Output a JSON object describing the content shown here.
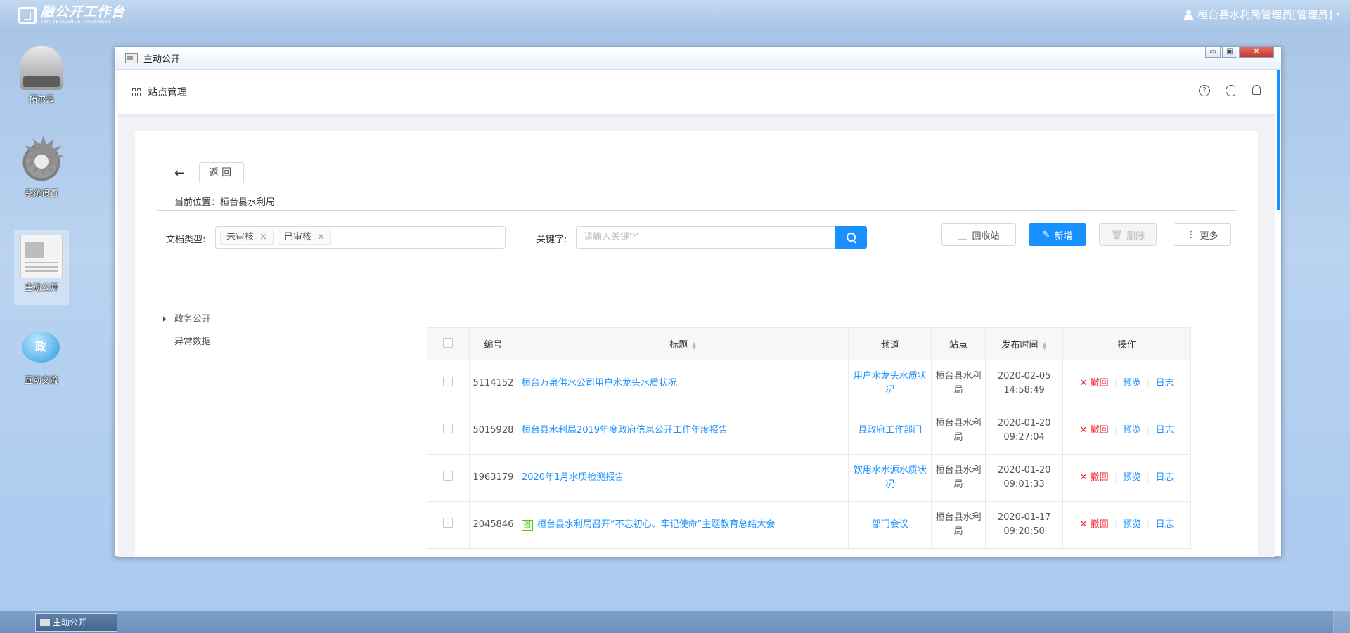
{
  "topbar": {
    "logo_title": "融公开工作台",
    "logo_sub": "CONVERGENCE OPENNESS",
    "user": "桓台县水利局管理员[管理员]"
  },
  "desktop": [
    {
      "label": "拓尔云"
    },
    {
      "label": "系统设置"
    },
    {
      "label": "主动公开"
    },
    {
      "label": "互动交流",
      "icon_text": "政"
    }
  ],
  "window": {
    "title": "主动公开",
    "header_title": "站点管理",
    "back_label": "返回",
    "location": "当前位置：桓台县水利局"
  },
  "filters": {
    "doc_type_label": "文档类型:",
    "tags": [
      "未审核",
      "已审核"
    ],
    "keyword_label": "关键字:",
    "keyword_placeholder": "请输入关键字",
    "recycle_label": "回收站",
    "new_label": "新增",
    "delete_label": "删除",
    "more_label": "更多"
  },
  "tree": {
    "root": "政务公开",
    "child": "异常数据"
  },
  "table": {
    "headers": {
      "id": "编号",
      "title": "标题",
      "channel": "频道",
      "site": "站点",
      "time": "发布时间",
      "ops": "操作"
    },
    "rows": [
      {
        "id": "5114152",
        "title": "桓台万泉供水公司用户水龙头水质状况",
        "channel": "用户水龙头水质状况",
        "site": "桓台县水利局",
        "date": "2020-02-05",
        "time": "14:58:49",
        "pic": ""
      },
      {
        "id": "5015928",
        "title": "桓台县水利局2019年度政府信息公开工作年度报告",
        "channel": "县政府工作部门",
        "site": "桓台县水利局",
        "date": "2020-01-20",
        "time": "09:27:04",
        "pic": ""
      },
      {
        "id": "1963179",
        "title": "2020年1月水质检测报告",
        "channel": "饮用水水源水质状况",
        "site": "桓台县水利局",
        "date": "2020-01-20",
        "time": "09:01:33",
        "pic": ""
      },
      {
        "id": "2045846",
        "title": "桓台县水利局召开“不忘初心、牢记使命”主题教育总结大会",
        "channel": "部门会议",
        "site": "桓台县水利局",
        "date": "2020-01-17",
        "time": "09:20:50",
        "pic": "图"
      }
    ],
    "ops": {
      "revoke": "撤回",
      "preview": "预览",
      "log": "日志"
    }
  },
  "taskbar": {
    "item": "主动公开"
  }
}
